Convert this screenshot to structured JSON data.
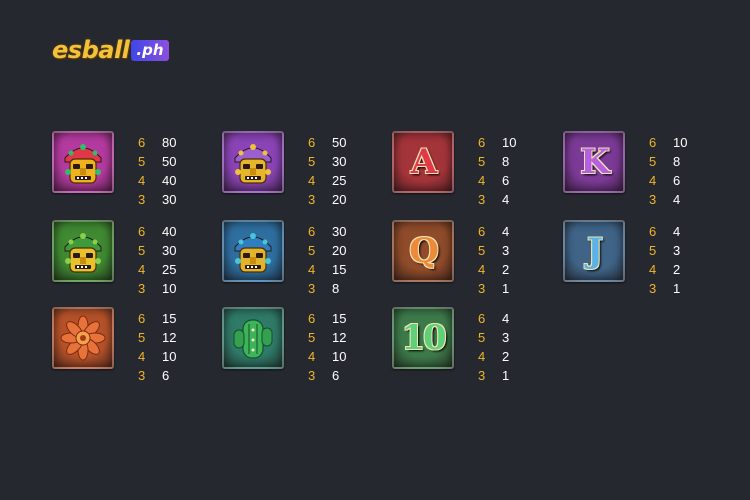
{
  "logo": {
    "main": "esball",
    "tld": ".ph"
  },
  "symbols": [
    {
      "id": "pink-mask",
      "label": "",
      "bg": "#b53aa0",
      "pays": [
        {
          "count": "6",
          "amount": "80"
        },
        {
          "count": "5",
          "amount": "50"
        },
        {
          "count": "4",
          "amount": "40"
        },
        {
          "count": "3",
          "amount": "30"
        }
      ]
    },
    {
      "id": "purple-mask",
      "label": "",
      "bg": "#8a44b6",
      "pays": [
        {
          "count": "6",
          "amount": "50"
        },
        {
          "count": "5",
          "amount": "30"
        },
        {
          "count": "4",
          "amount": "25"
        },
        {
          "count": "3",
          "amount": "20"
        }
      ]
    },
    {
      "id": "letter-a",
      "label": "A",
      "bg": "#a3343a",
      "pays": [
        {
          "count": "6",
          "amount": "10"
        },
        {
          "count": "5",
          "amount": "8"
        },
        {
          "count": "4",
          "amount": "6"
        },
        {
          "count": "3",
          "amount": "4"
        }
      ]
    },
    {
      "id": "letter-k",
      "label": "K",
      "bg": "#7b3a96",
      "pays": [
        {
          "count": "6",
          "amount": "10"
        },
        {
          "count": "5",
          "amount": "8"
        },
        {
          "count": "4",
          "amount": "6"
        },
        {
          "count": "3",
          "amount": "4"
        }
      ]
    },
    {
      "id": "green-mask",
      "label": "",
      "bg": "#3f8a32",
      "pays": [
        {
          "count": "6",
          "amount": "40"
        },
        {
          "count": "5",
          "amount": "30"
        },
        {
          "count": "4",
          "amount": "25"
        },
        {
          "count": "3",
          "amount": "10"
        }
      ]
    },
    {
      "id": "blue-mask",
      "label": "",
      "bg": "#2e6fa0",
      "pays": [
        {
          "count": "6",
          "amount": "30"
        },
        {
          "count": "5",
          "amount": "20"
        },
        {
          "count": "4",
          "amount": "15"
        },
        {
          "count": "3",
          "amount": "8"
        }
      ]
    },
    {
      "id": "letter-q",
      "label": "Q",
      "bg": "#8f4b2a",
      "pays": [
        {
          "count": "6",
          "amount": "4"
        },
        {
          "count": "5",
          "amount": "3"
        },
        {
          "count": "4",
          "amount": "2"
        },
        {
          "count": "3",
          "amount": "1"
        }
      ]
    },
    {
      "id": "letter-j",
      "label": "J",
      "bg": "#3f6487",
      "pays": [
        {
          "count": "6",
          "amount": "4"
        },
        {
          "count": "5",
          "amount": "3"
        },
        {
          "count": "4",
          "amount": "2"
        },
        {
          "count": "3",
          "amount": "1"
        }
      ]
    },
    {
      "id": "orange-flower",
      "label": "",
      "bg": "#b5522a",
      "pays": [
        {
          "count": "6",
          "amount": "15"
        },
        {
          "count": "5",
          "amount": "12"
        },
        {
          "count": "4",
          "amount": "10"
        },
        {
          "count": "3",
          "amount": "6"
        }
      ]
    },
    {
      "id": "green-cactus",
      "label": "",
      "bg": "#2f7a68",
      "pays": [
        {
          "count": "6",
          "amount": "15"
        },
        {
          "count": "5",
          "amount": "12"
        },
        {
          "count": "4",
          "amount": "10"
        },
        {
          "count": "3",
          "amount": "6"
        }
      ]
    },
    {
      "id": "number-10",
      "label": "10",
      "bg": "#3d7a4a",
      "pays": [
        {
          "count": "6",
          "amount": "4"
        },
        {
          "count": "5",
          "amount": "3"
        },
        {
          "count": "4",
          "amount": "2"
        },
        {
          "count": "3",
          "amount": "1"
        }
      ]
    }
  ]
}
